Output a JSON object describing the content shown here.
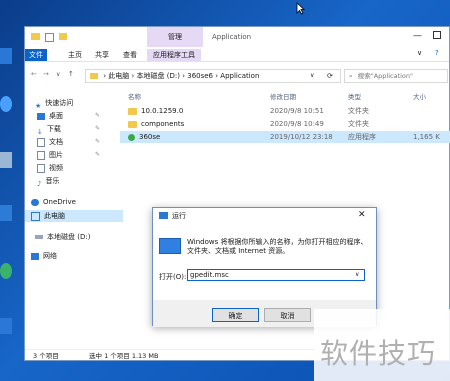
{
  "explorer": {
    "title": "Application",
    "context_tab": "管理",
    "tabs": [
      "文件",
      "主页",
      "共享",
      "查看",
      "应用程序工具"
    ],
    "breadcrumb": [
      "此电脑",
      "本地磁盘 (D:)",
      "360se6",
      "Application"
    ],
    "search_placeholder": "搜索\"Application\"",
    "nav": [
      "快速访问",
      "桌面",
      "下载",
      "文档",
      "图片",
      "视频",
      "音乐",
      "OneDrive",
      "此电脑",
      "本地磁盘 (D:)",
      "网络"
    ],
    "columns": [
      "名称",
      "修改日期",
      "类型",
      "大小"
    ],
    "files": [
      {
        "name": "10.0.1259.0",
        "date": "2020/9/8 10:51",
        "type": "文件夹",
        "size": ""
      },
      {
        "name": "components",
        "date": "2020/9/8 10:49",
        "type": "文件夹",
        "size": ""
      },
      {
        "name": "360se",
        "date": "2019/10/12 23:18",
        "type": "应用程序",
        "size": "1,165 K"
      }
    ],
    "status": "3 个项目",
    "status_selected": "选中 1 个项目 1.13 MB"
  },
  "run_dialog": {
    "title": "运行",
    "description": "Windows 将根据你所输入的名称，为你打开相应的程序、文件夹、文档或 Internet 资源。",
    "open_label": "打开(O):",
    "command": "gpedit.msc",
    "ok": "确定",
    "cancel": "取消"
  },
  "watermark": "软件技巧",
  "colors": {
    "accent": "#0a63c9",
    "context_tab": "#e6d9f5",
    "selection": "#cce8ff"
  }
}
